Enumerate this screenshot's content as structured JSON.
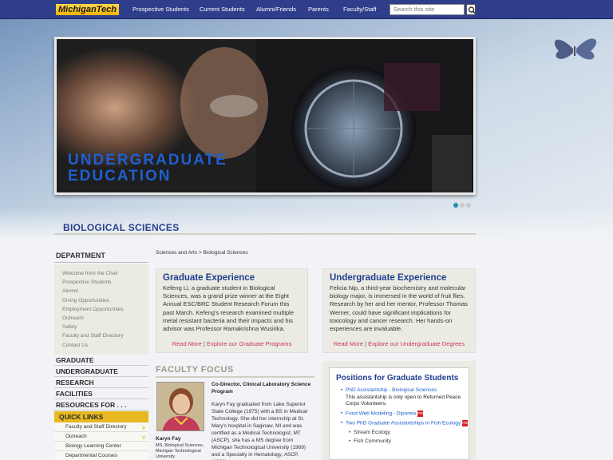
{
  "header": {
    "logo": "MichiganTech",
    "nav": [
      "Prospective Students",
      "Current Students",
      "Alumni/Friends",
      "Parents",
      "Faculty/Staff"
    ],
    "search_placeholder": "Search this site"
  },
  "hero": {
    "title": "UNDERGRADUATE EDUCATION",
    "slides": 3,
    "active_slide": 1
  },
  "page_title": "BIOLOGICAL SCIENCES",
  "breadcrumb": {
    "parent": "Sciences and Arts",
    "separator": ">",
    "current": "Biological Sciences"
  },
  "sidebar": {
    "department_heading": "DEPARTMENT",
    "department_links": [
      "Welcome from the Chair",
      "Prospective Students",
      "Alumni",
      "Giving Opportunities",
      "Employment Opportunities",
      "Outreach",
      "Safety",
      "Faculty and Staff Directory",
      "Contact Us"
    ],
    "main_links": [
      "GRADUATE",
      "UNDERGRADUATE",
      "RESEARCH",
      "FACILITIES",
      "RESOURCES FOR . . ."
    ],
    "quick_links_heading": "QUICK LINKS",
    "quick_links": [
      "Faculty and Staff Directory",
      "Outreach",
      "Biology Learning Center",
      "Departmental Courses"
    ]
  },
  "graduate_box": {
    "title": "Graduate Experience",
    "body": "Kefeng Li, a graduate student in Biological Sciences, was a grand prize winner at the Eight Annual ESC/BRC Student Research Forum this past March. Kefeng's research examined multiple metal resistant bacteria and their impacts and his advisor was Professor Ramakrishna Wusirika.",
    "link1": "Read More",
    "sep": "|",
    "link2": "Explore our Graduate Programs"
  },
  "undergrad_box": {
    "title": "Undergraduate Experience",
    "body": "Felicia Nip, a third-year biochemistry and molecular biology major, is immersed in the world of fruit flies. Research by her and her mentor, Professor Thomas Werner, could have significant implications for toxicology and cancer research. Her hands-on experiences are invaluable.",
    "link1": "Read More",
    "sep": "|",
    "link2": "Explore our Undergraduate Degrees"
  },
  "faculty_focus": {
    "heading": "FACULTY FOCUS",
    "name": "Karyn Fay",
    "desc": "MS, Biological Sciences, Michigan Technological University",
    "title": "Co-Director, Clinical Laboratory Science Program",
    "bio": "Karyn Fay graduated from Lake Superior State College (1975) with a BS in Medical Technology. She did her internship at St. Mary's hospital in Saginaw, MI and was certified as a Medical Technologist, MT (ASCP), she has a MS degree from Michigan Technological University (1989) and a Specialty in Hematology, ASCP, (1993)."
  },
  "positions": {
    "heading": "Positions for Graduate Students",
    "item1_link": "PhD Assistantship - Biological Sciences",
    "item1_note": "This assistantship is only open to Returned Peace Corps Volunteers.",
    "item2_link": "Food Web Modeling - Diporeia",
    "item3_link": "Two PhD Graduate Assistantships in Fish Ecology",
    "sub1": "Stream Ecology",
    "sub2": "Fish Community",
    "pdf_label": "PDF"
  }
}
